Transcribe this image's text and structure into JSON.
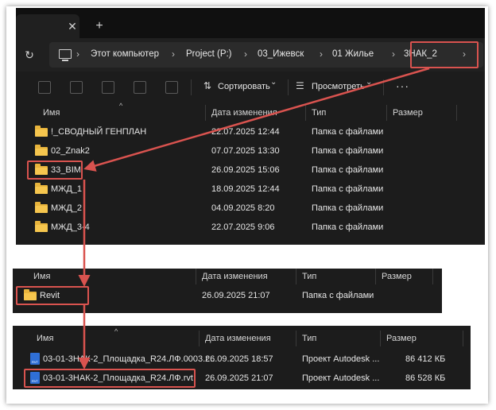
{
  "tabbar": {
    "close_glyph": "✕",
    "new_glyph": "+"
  },
  "address": {
    "refresh_glyph": "↻",
    "crumbs": [
      "Этот компьютер",
      "Project (P:)",
      "03_Ижевск",
      "01 Жилье",
      "3НАК_2"
    ],
    "separator": "›",
    "end_chevron": "›"
  },
  "toolbar": {
    "sort_label": "Сортировать",
    "view_label": "Просмотреть",
    "dropdown_glyph": "⌄",
    "more_glyph": "···"
  },
  "columns": {
    "name": "Имя",
    "date": "Дата изменения",
    "type": "Тип",
    "size": "Размер"
  },
  "panel1": {
    "rows": [
      {
        "name": "!_СВОДНЫЙ ГЕНПЛАН",
        "date": "22.07.2025 12:44",
        "type": "Папка с файлами",
        "size": ""
      },
      {
        "name": "02_Znak2",
        "date": "07.07.2025 13:30",
        "type": "Папка с файлами",
        "size": ""
      },
      {
        "name": "33_BIM",
        "date": "26.09.2025 15:06",
        "type": "Папка с файлами",
        "size": ""
      },
      {
        "name": "МЖД_1",
        "date": "18.09.2025 12:44",
        "type": "Папка с файлами",
        "size": ""
      },
      {
        "name": "МЖД_2",
        "date": "04.09.2025 8:20",
        "type": "Папка с файлами",
        "size": ""
      },
      {
        "name": "МЖД_3-4",
        "date": "22.07.2025 9:06",
        "type": "Папка с файлами",
        "size": ""
      }
    ]
  },
  "panel2": {
    "rows": [
      {
        "name": "Revit",
        "date": "26.09.2025 21:07",
        "type": "Папка с файлами",
        "size": ""
      }
    ]
  },
  "panel3": {
    "rows": [
      {
        "name": "03-01-3НАК-2_Площадка_R24.ЛФ.0003.r...",
        "date": "26.09.2025 18:57",
        "type": "Проект Autodesk ...",
        "size": "86 412 КБ"
      },
      {
        "name": "03-01-3НАК-2_Площадка_R24.ЛФ.rvt",
        "date": "26.09.2025 21:07",
        "type": "Проект Autodesk ...",
        "size": "86 528 КБ"
      }
    ]
  },
  "colors": {
    "highlight": "#d9534f",
    "folder": "#f6c64e",
    "background": "#1c1c1c"
  }
}
